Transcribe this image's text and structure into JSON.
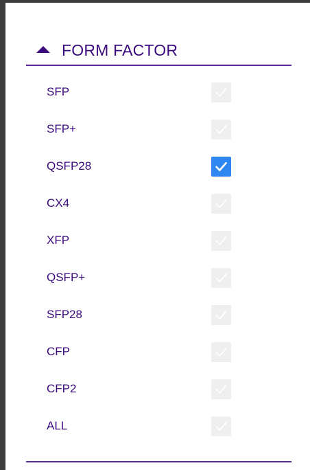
{
  "filter": {
    "title": "FORM FACTOR",
    "options": [
      {
        "label": "SFP",
        "checked": false
      },
      {
        "label": "SFP+",
        "checked": false
      },
      {
        "label": "QSFP28",
        "checked": true
      },
      {
        "label": "CX4",
        "checked": false
      },
      {
        "label": "XFP",
        "checked": false
      },
      {
        "label": "QSFP+",
        "checked": false
      },
      {
        "label": "SFP28",
        "checked": false
      },
      {
        "label": "CFP",
        "checked": false
      },
      {
        "label": "CFP2",
        "checked": false
      },
      {
        "label": "ALL",
        "checked": false
      }
    ]
  },
  "colors": {
    "accent": "#3b0a7d",
    "checked": "#2e86f0",
    "unchecked": "#efefef",
    "checkmark_unchecked": "#ffffff",
    "frame": "#3d3d3d"
  },
  "icons": {
    "collapse": "caret-up-icon",
    "check": "checkmark-icon"
  }
}
